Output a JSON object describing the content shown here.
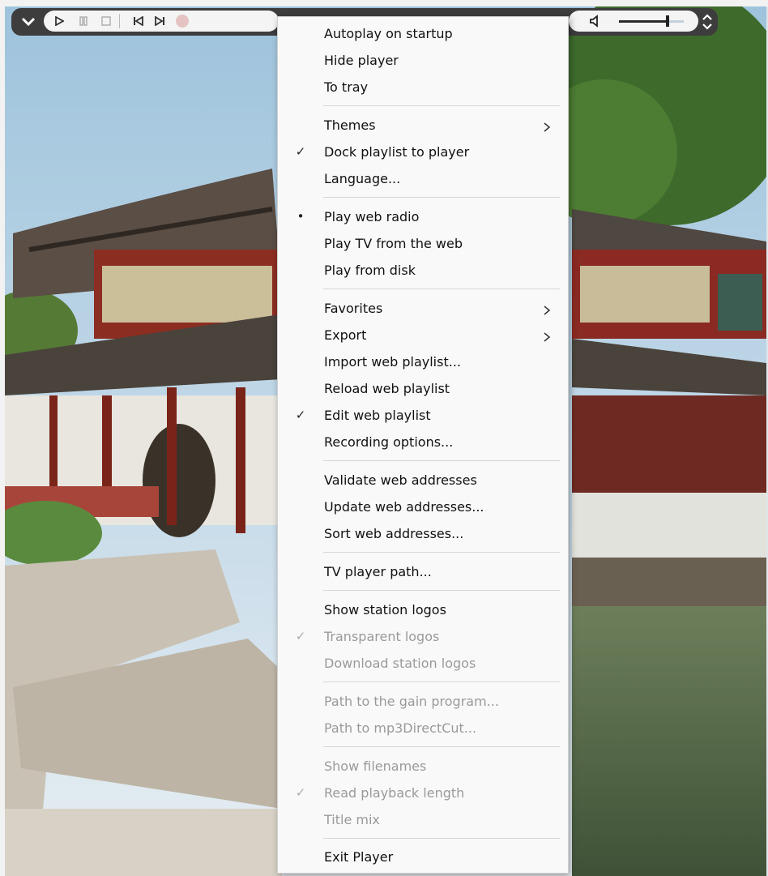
{
  "menu": {
    "autoplay": "Autoplay on startup",
    "hide_player": "Hide player",
    "to_tray": "To tray",
    "themes": "Themes",
    "dock_playlist": "Dock playlist to player",
    "language": "Language...",
    "play_web_radio": "Play web radio",
    "play_tv": "Play TV from the web",
    "play_disk": "Play from disk",
    "favorites": "Favorites",
    "export": "Export",
    "import_playlist": "Import web playlist...",
    "reload_playlist": "Reload web playlist",
    "edit_playlist": "Edit web playlist",
    "recording_options": "Recording options...",
    "validate_addresses": "Validate web addresses",
    "update_addresses": "Update web addresses...",
    "sort_addresses": "Sort web addresses...",
    "tv_player_path": "TV player path...",
    "show_logos": "Show station logos",
    "transparent_logos": "Transparent logos",
    "download_logos": "Download station logos",
    "gain_path": "Path to the gain program...",
    "mp3cut_path": "Path to mp3DirectCut...",
    "show_filenames": "Show filenames",
    "read_length": "Read playback length",
    "title_mix": "Title mix",
    "exit": "Exit Player"
  },
  "marks": {
    "check": "✓",
    "bullet": "•"
  },
  "player": {
    "volume_level": 0.75,
    "accent_record": "#e6c3c3"
  }
}
